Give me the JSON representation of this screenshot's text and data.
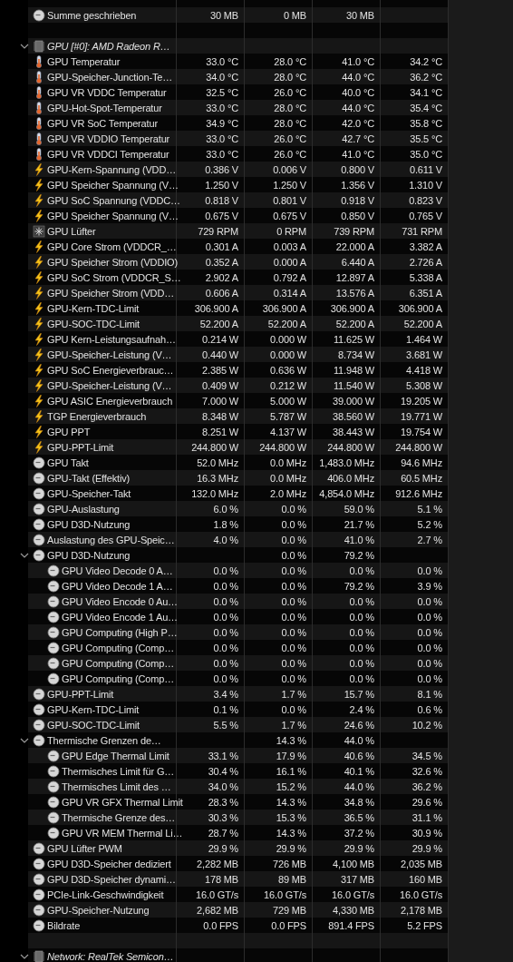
{
  "groups": [
    {
      "rows": [
        {
          "label": "Summe geschrieben",
          "kind": "clock",
          "column_2": "30 MB",
          "column_3": "0 MB",
          "column_4": "30 MB"
        }
      ]
    },
    {
      "title": "GPU [#0]: AMD Radeon R…",
      "expanded": true,
      "rows": [
        {
          "label": "GPU Temperatur",
          "kind": "temperature",
          "column_2": "33.0 °C",
          "column_3": "28.0 °C",
          "column_4": "41.0 °C",
          "column_5": "34.2 °C"
        },
        {
          "label": "GPU-Speicher-Junction-Te…",
          "kind": "temperature",
          "column_2": "34.0 °C",
          "column_3": "28.0 °C",
          "column_4": "44.0 °C",
          "column_5": "36.2 °C"
        },
        {
          "label": "GPU VR VDDC Temperatur",
          "kind": "temperature",
          "column_2": "32.5 °C",
          "column_3": "26.0 °C",
          "column_4": "40.0 °C",
          "column_5": "34.1 °C"
        },
        {
          "label": "GPU-Hot-Spot-Temperatur",
          "kind": "temperature",
          "column_2": "33.0 °C",
          "column_3": "28.0 °C",
          "column_4": "44.0 °C",
          "column_5": "35.4 °C"
        },
        {
          "label": "GPU VR SoC Temperatur",
          "kind": "temperature",
          "column_2": "34.9 °C",
          "column_3": "28.0 °C",
          "column_4": "42.0 °C",
          "column_5": "35.8 °C"
        },
        {
          "label": "GPU VR VDDIO Temperatur",
          "kind": "temperature",
          "column_2": "33.0 °C",
          "column_3": "26.0 °C",
          "column_4": "42.7 °C",
          "column_5": "35.5 °C"
        },
        {
          "label": "GPU VR VDDCI Temperatur",
          "kind": "temperature",
          "column_2": "33.0 °C",
          "column_3": "26.0 °C",
          "column_4": "41.0 °C",
          "column_5": "35.0 °C"
        },
        {
          "label": "GPU-Kern-Spannung (VDD…",
          "kind": "electric",
          "column_2": "0.386 V",
          "column_3": "0.006 V",
          "column_4": "0.800 V",
          "column_5": "0.611 V"
        },
        {
          "label": "GPU Speicher Spannung (V…",
          "kind": "electric",
          "column_2": "1.250 V",
          "column_3": "1.250 V",
          "column_4": "1.356 V",
          "column_5": "1.310 V"
        },
        {
          "label": "GPU SoC Spannung (VDDC…",
          "kind": "electric",
          "column_2": "0.818 V",
          "column_3": "0.801 V",
          "column_4": "0.918 V",
          "column_5": "0.823 V"
        },
        {
          "label": "GPU Speicher Spannung (V…",
          "kind": "electric",
          "column_2": "0.675 V",
          "column_3": "0.675 V",
          "column_4": "0.850 V",
          "column_5": "0.765 V"
        },
        {
          "label": "GPU Lüfter",
          "kind": "fan",
          "column_2": "729 RPM",
          "column_3": "0 RPM",
          "column_4": "739 RPM",
          "column_5": "731 RPM"
        },
        {
          "label": "GPU Core Strom (VDDCR_…",
          "kind": "electric",
          "column_2": "0.301 A",
          "column_3": "0.003 A",
          "column_4": "22.000 A",
          "column_5": "3.382 A"
        },
        {
          "label": "GPU Speicher Strom (VDDIO)",
          "kind": "electric",
          "column_2": "0.352 A",
          "column_3": "0.000 A",
          "column_4": "6.440 A",
          "column_5": "2.726 A"
        },
        {
          "label": "GPU SoC Strom (VDDCR_S…",
          "kind": "electric",
          "column_2": "2.902 A",
          "column_3": "0.792 A",
          "column_4": "12.897 A",
          "column_5": "5.338 A"
        },
        {
          "label": "GPU Speicher Strom (VDD…",
          "kind": "electric",
          "column_2": "0.606 A",
          "column_3": "0.314 A",
          "column_4": "13.576 A",
          "column_5": "6.351 A"
        },
        {
          "label": "GPU-Kern-TDC-Limit",
          "kind": "electric",
          "column_2": "306.900 A",
          "column_3": "306.900 A",
          "column_4": "306.900 A",
          "column_5": "306.900 A"
        },
        {
          "label": "GPU-SOC-TDC-Limit",
          "kind": "electric",
          "column_2": "52.200 A",
          "column_3": "52.200 A",
          "column_4": "52.200 A",
          "column_5": "52.200 A"
        },
        {
          "label": "GPU Kern-Leistungsaufnah…",
          "kind": "electric",
          "column_2": "0.214 W",
          "column_3": "0.000 W",
          "column_4": "11.625 W",
          "column_5": "1.464 W"
        },
        {
          "label": "GPU-Speicher-Leistung (V…",
          "kind": "electric",
          "column_2": "0.440 W",
          "column_3": "0.000 W",
          "column_4": "8.734 W",
          "column_5": "3.681 W"
        },
        {
          "label": "GPU SoC Energieverbrauc…",
          "kind": "electric",
          "column_2": "2.385 W",
          "column_3": "0.636 W",
          "column_4": "11.948 W",
          "column_5": "4.418 W"
        },
        {
          "label": "GPU-Speicher-Leistung (V…",
          "kind": "electric",
          "column_2": "0.409 W",
          "column_3": "0.212 W",
          "column_4": "11.540 W",
          "column_5": "5.308 W"
        },
        {
          "label": "GPU ASIC Energieverbrauch",
          "kind": "electric",
          "column_2": "7.000 W",
          "column_3": "5.000 W",
          "column_4": "39.000 W",
          "column_5": "19.205 W"
        },
        {
          "label": "TGP Energieverbrauch",
          "kind": "electric",
          "column_2": "8.348 W",
          "column_3": "5.787 W",
          "column_4": "38.560 W",
          "column_5": "19.771 W"
        },
        {
          "label": "GPU PPT",
          "kind": "electric",
          "column_2": "8.251 W",
          "column_3": "4.137 W",
          "column_4": "38.443 W",
          "column_5": "19.754 W"
        },
        {
          "label": "GPU-PPT-Limit",
          "kind": "electric",
          "column_2": "244.800 W",
          "column_3": "244.800 W",
          "column_4": "244.800 W",
          "column_5": "244.800 W"
        },
        {
          "label": "GPU Takt",
          "kind": "clock",
          "column_2": "52.0 MHz",
          "column_3": "0.0 MHz",
          "column_4": "1,483.0 MHz",
          "column_5": "94.6 MHz"
        },
        {
          "label": "GPU-Takt (Effektiv)",
          "kind": "clock",
          "column_2": "16.3 MHz",
          "column_3": "0.0 MHz",
          "column_4": "406.0 MHz",
          "column_5": "60.5 MHz"
        },
        {
          "label": "GPU-Speicher-Takt",
          "kind": "clock",
          "column_2": "132.0 MHz",
          "column_3": "2.0 MHz",
          "column_4": "4,854.0 MHz",
          "column_5": "912.6 MHz"
        },
        {
          "label": "GPU-Auslastung",
          "kind": "clock",
          "column_2": "6.0 %",
          "column_3": "0.0 %",
          "column_4": "59.0 %",
          "column_5": "5.1 %"
        },
        {
          "label": "GPU D3D-Nutzung",
          "kind": "clock",
          "column_2": "1.8 %",
          "column_3": "0.0 %",
          "column_4": "21.7 %",
          "column_5": "5.2 %"
        },
        {
          "label": "Auslastung des GPU-Speic…",
          "kind": "clock",
          "column_2": "4.0 %",
          "column_3": "0.0 %",
          "column_4": "41.0 %",
          "column_5": "2.7 %"
        },
        {
          "label": "GPU D3D-Nutzung",
          "kind": "clock",
          "column_3": "0.0 %",
          "column_4": "79.2 %",
          "expanded": true,
          "children": [
            {
              "label": "GPU Video Decode 0 A…",
              "kind": "clock",
              "column_2": "0.0 %",
              "column_3": "0.0 %",
              "column_4": "0.0 %",
              "column_5": "0.0 %"
            },
            {
              "label": "GPU Video Decode 1 A…",
              "kind": "clock",
              "column_2": "0.0 %",
              "column_3": "0.0 %",
              "column_4": "79.2 %",
              "column_5": "3.9 %"
            },
            {
              "label": "GPU Video Encode 0 Au…",
              "kind": "clock",
              "column_2": "0.0 %",
              "column_3": "0.0 %",
              "column_4": "0.0 %",
              "column_5": "0.0 %"
            },
            {
              "label": "GPU Video Encode 1 Au…",
              "kind": "clock",
              "column_2": "0.0 %",
              "column_3": "0.0 %",
              "column_4": "0.0 %",
              "column_5": "0.0 %"
            },
            {
              "label": "GPU Computing (High P…",
              "kind": "clock",
              "column_2": "0.0 %",
              "column_3": "0.0 %",
              "column_4": "0.0 %",
              "column_5": "0.0 %"
            },
            {
              "label": "GPU Computing (Comp…",
              "kind": "clock",
              "column_2": "0.0 %",
              "column_3": "0.0 %",
              "column_4": "0.0 %",
              "column_5": "0.0 %"
            },
            {
              "label": "GPU Computing (Comp…",
              "kind": "clock",
              "column_2": "0.0 %",
              "column_3": "0.0 %",
              "column_4": "0.0 %",
              "column_5": "0.0 %"
            },
            {
              "label": "GPU Computing (Comp…",
              "kind": "clock",
              "column_2": "0.0 %",
              "column_3": "0.0 %",
              "column_4": "0.0 %",
              "column_5": "0.0 %"
            }
          ]
        },
        {
          "label": "GPU-PPT-Limit",
          "kind": "clock",
          "column_2": "3.4 %",
          "column_3": "1.7 %",
          "column_4": "15.7 %",
          "column_5": "8.1 %"
        },
        {
          "label": "GPU-Kern-TDC-Limit",
          "kind": "clock",
          "column_2": "0.1 %",
          "column_3": "0.0 %",
          "column_4": "2.4 %",
          "column_5": "0.6 %"
        },
        {
          "label": "GPU-SOC-TDC-Limit",
          "kind": "clock",
          "column_2": "5.5 %",
          "column_3": "1.7 %",
          "column_4": "24.6 %",
          "column_5": "10.2 %"
        },
        {
          "label": "Thermische Grenzen de…",
          "kind": "clock",
          "column_3": "14.3 %",
          "column_4": "44.0 %",
          "expanded": true,
          "children": [
            {
              "label": "GPU Edge Thermal Limit",
              "kind": "clock",
              "column_2": "33.1 %",
              "column_3": "17.9 %",
              "column_4": "40.6 %",
              "column_5": "34.5 %"
            },
            {
              "label": "Thermisches Limit für G…",
              "kind": "clock",
              "column_2": "30.4 %",
              "column_3": "16.1 %",
              "column_4": "40.1 %",
              "column_5": "32.6 %"
            },
            {
              "label": "Thermisches Limit des …",
              "kind": "clock",
              "column_2": "34.0 %",
              "column_3": "15.2 %",
              "column_4": "44.0 %",
              "column_5": "36.2 %"
            },
            {
              "label": "GPU VR GFX Thermal Limit",
              "kind": "clock",
              "column_2": "28.3 %",
              "column_3": "14.3 %",
              "column_4": "34.8 %",
              "column_5": "29.6 %"
            },
            {
              "label": "Thermische Grenze des…",
              "kind": "clock",
              "column_2": "30.3 %",
              "column_3": "15.3 %",
              "column_4": "36.5 %",
              "column_5": "31.1 %"
            },
            {
              "label": "GPU VR MEM Thermal Li…",
              "kind": "clock",
              "column_2": "28.7 %",
              "column_3": "14.3 %",
              "column_4": "37.2 %",
              "column_5": "30.9 %"
            }
          ]
        },
        {
          "label": "GPU Lüfter PWM",
          "kind": "clock",
          "column_2": "29.9 %",
          "column_3": "29.9 %",
          "column_4": "29.9 %",
          "column_5": "29.9 %"
        },
        {
          "label": "GPU D3D-Speicher dediziert",
          "kind": "clock",
          "column_2": "2,282 MB",
          "column_3": "726 MB",
          "column_4": "4,100 MB",
          "column_5": "2,035 MB"
        },
        {
          "label": "GPU D3D-Speicher dynami…",
          "kind": "clock",
          "column_2": "178 MB",
          "column_3": "89 MB",
          "column_4": "317 MB",
          "column_5": "160 MB"
        },
        {
          "label": "PCIe-Link-Geschwindigkeit",
          "kind": "clock",
          "column_2": "16.0 GT/s",
          "column_3": "16.0 GT/s",
          "column_4": "16.0 GT/s",
          "column_5": "16.0 GT/s"
        },
        {
          "label": "GPU-Speicher-Nutzung",
          "kind": "clock",
          "column_2": "2,682 MB",
          "column_3": "729 MB",
          "column_4": "4,330 MB",
          "column_5": "2,178 MB"
        },
        {
          "label": "Bildrate",
          "kind": "clock",
          "column_2": "0.0 FPS",
          "column_3": "0.0 FPS",
          "column_4": "891.4 FPS",
          "column_5": "5.2 FPS"
        }
      ]
    },
    {
      "title": "Network: RealTek Semicon…",
      "expanded": true
    }
  ]
}
